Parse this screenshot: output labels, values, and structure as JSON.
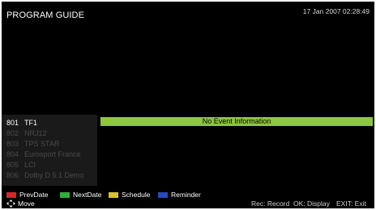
{
  "header": {
    "title": "PROGRAM GUIDE",
    "datetime": "17 Jan 2007 02:28:49"
  },
  "channels": [
    {
      "number": "801",
      "name": "TF1",
      "selected": true
    },
    {
      "number": "802",
      "name": "NRJ12",
      "selected": false
    },
    {
      "number": "803",
      "name": "TPS STAR",
      "selected": false
    },
    {
      "number": "804",
      "name": "Eurosport France",
      "selected": false
    },
    {
      "number": "805",
      "name": "LCI",
      "selected": false
    },
    {
      "number": "806",
      "name": "Dolby D 5.1 Demo",
      "selected": false
    }
  ],
  "event": {
    "text": "No Event Information",
    "color": "#8dc63f"
  },
  "legend": {
    "red": {
      "label": "PrevDate",
      "color": "#d9262a"
    },
    "green": {
      "label": "NextDate",
      "color": "#2fae3a"
    },
    "yellow": {
      "label": "Schedule",
      "color": "#d8c12b"
    },
    "blue": {
      "label": "Reminder",
      "color": "#2a49b8"
    }
  },
  "footer": {
    "move": "Move",
    "move_icon": "arrow-keys-icon",
    "rec": "Rec: Record",
    "ok": "OK: Display",
    "exit": "EXIT: Exit"
  }
}
